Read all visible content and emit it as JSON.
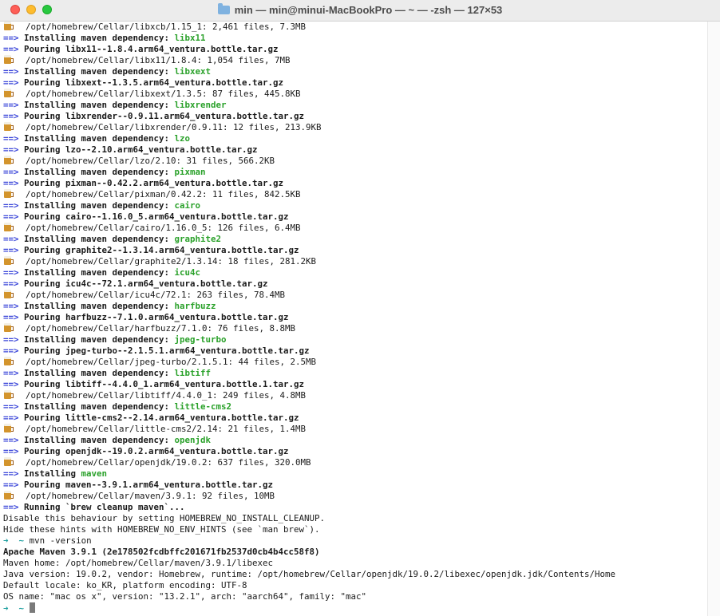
{
  "window": {
    "title": "min — min@minui-MacBookPro — ~ — -zsh — 127×53"
  },
  "terminal": {
    "arrow": "==>",
    "lines": [
      {
        "type": "path",
        "text": "/opt/homebrew/Cellar/libxcb/1.15_1: 2,461 files, 7.3MB"
      },
      {
        "type": "dep",
        "prefix": "Installing maven dependency: ",
        "pkg": "libx11"
      },
      {
        "type": "pour",
        "text": "Pouring libx11--1.8.4.arm64_ventura.bottle.tar.gz"
      },
      {
        "type": "path",
        "text": "/opt/homebrew/Cellar/libx11/1.8.4: 1,054 files, 7MB"
      },
      {
        "type": "dep",
        "prefix": "Installing maven dependency: ",
        "pkg": "libxext"
      },
      {
        "type": "pour",
        "text": "Pouring libxext--1.3.5.arm64_ventura.bottle.tar.gz"
      },
      {
        "type": "path",
        "text": "/opt/homebrew/Cellar/libxext/1.3.5: 87 files, 445.8KB"
      },
      {
        "type": "dep",
        "prefix": "Installing maven dependency: ",
        "pkg": "libxrender"
      },
      {
        "type": "pour",
        "text": "Pouring libxrender--0.9.11.arm64_ventura.bottle.tar.gz"
      },
      {
        "type": "path",
        "text": "/opt/homebrew/Cellar/libxrender/0.9.11: 12 files, 213.9KB"
      },
      {
        "type": "dep",
        "prefix": "Installing maven dependency: ",
        "pkg": "lzo"
      },
      {
        "type": "pour",
        "text": "Pouring lzo--2.10.arm64_ventura.bottle.tar.gz"
      },
      {
        "type": "path",
        "text": "/opt/homebrew/Cellar/lzo/2.10: 31 files, 566.2KB"
      },
      {
        "type": "dep",
        "prefix": "Installing maven dependency: ",
        "pkg": "pixman"
      },
      {
        "type": "pour",
        "text": "Pouring pixman--0.42.2.arm64_ventura.bottle.tar.gz"
      },
      {
        "type": "path",
        "text": "/opt/homebrew/Cellar/pixman/0.42.2: 11 files, 842.5KB"
      },
      {
        "type": "dep",
        "prefix": "Installing maven dependency: ",
        "pkg": "cairo"
      },
      {
        "type": "pour",
        "text": "Pouring cairo--1.16.0_5.arm64_ventura.bottle.tar.gz"
      },
      {
        "type": "path",
        "text": "/opt/homebrew/Cellar/cairo/1.16.0_5: 126 files, 6.4MB"
      },
      {
        "type": "dep",
        "prefix": "Installing maven dependency: ",
        "pkg": "graphite2"
      },
      {
        "type": "pour",
        "text": "Pouring graphite2--1.3.14.arm64_ventura.bottle.tar.gz"
      },
      {
        "type": "path",
        "text": "/opt/homebrew/Cellar/graphite2/1.3.14: 18 files, 281.2KB"
      },
      {
        "type": "dep",
        "prefix": "Installing maven dependency: ",
        "pkg": "icu4c"
      },
      {
        "type": "pour",
        "text": "Pouring icu4c--72.1.arm64_ventura.bottle.tar.gz"
      },
      {
        "type": "path",
        "text": "/opt/homebrew/Cellar/icu4c/72.1: 263 files, 78.4MB"
      },
      {
        "type": "dep",
        "prefix": "Installing maven dependency: ",
        "pkg": "harfbuzz"
      },
      {
        "type": "pour",
        "text": "Pouring harfbuzz--7.1.0.arm64_ventura.bottle.tar.gz"
      },
      {
        "type": "path",
        "text": "/opt/homebrew/Cellar/harfbuzz/7.1.0: 76 files, 8.8MB"
      },
      {
        "type": "dep",
        "prefix": "Installing maven dependency: ",
        "pkg": "jpeg-turbo"
      },
      {
        "type": "pour",
        "text": "Pouring jpeg-turbo--2.1.5.1.arm64_ventura.bottle.tar.gz"
      },
      {
        "type": "path",
        "text": "/opt/homebrew/Cellar/jpeg-turbo/2.1.5.1: 44 files, 2.5MB"
      },
      {
        "type": "dep",
        "prefix": "Installing maven dependency: ",
        "pkg": "libtiff"
      },
      {
        "type": "pour",
        "text": "Pouring libtiff--4.4.0_1.arm64_ventura.bottle.1.tar.gz"
      },
      {
        "type": "path",
        "text": "/opt/homebrew/Cellar/libtiff/4.4.0_1: 249 files, 4.8MB"
      },
      {
        "type": "dep",
        "prefix": "Installing maven dependency: ",
        "pkg": "little-cms2"
      },
      {
        "type": "pour",
        "text": "Pouring little-cms2--2.14.arm64_ventura.bottle.tar.gz"
      },
      {
        "type": "path",
        "text": "/opt/homebrew/Cellar/little-cms2/2.14: 21 files, 1.4MB"
      },
      {
        "type": "dep",
        "prefix": "Installing maven dependency: ",
        "pkg": "openjdk"
      },
      {
        "type": "pour",
        "text": "Pouring openjdk--19.0.2.arm64_ventura.bottle.tar.gz"
      },
      {
        "type": "path",
        "text": "/opt/homebrew/Cellar/openjdk/19.0.2: 637 files, 320.0MB"
      },
      {
        "type": "dep",
        "prefix": "Installing ",
        "pkg": "maven"
      },
      {
        "type": "pour",
        "text": "Pouring maven--3.9.1.arm64_ventura.bottle.tar.gz"
      },
      {
        "type": "path",
        "text": "/opt/homebrew/Cellar/maven/3.9.1: 92 files, 10MB"
      },
      {
        "type": "pour",
        "text": "Running `brew cleanup maven`..."
      },
      {
        "type": "plain",
        "text": "Disable this behaviour by setting HOMEBREW_NO_INSTALL_CLEANUP."
      },
      {
        "type": "plain",
        "text": "Hide these hints with HOMEBREW_NO_ENV_HINTS (see `man brew`)."
      },
      {
        "type": "prompt",
        "symbol": "➜",
        "dir": "~",
        "cmd": "mvn -version"
      },
      {
        "type": "boldplain",
        "text": "Apache Maven 3.9.1 (2e178502fcdbffc201671fb2537d0cb4b4cc58f8)"
      },
      {
        "type": "plain",
        "text": "Maven home: /opt/homebrew/Cellar/maven/3.9.1/libexec"
      },
      {
        "type": "plain",
        "text": "Java version: 19.0.2, vendor: Homebrew, runtime: /opt/homebrew/Cellar/openjdk/19.0.2/libexec/openjdk.jdk/Contents/Home"
      },
      {
        "type": "plain",
        "text": "Default locale: ko_KR, platform encoding: UTF-8"
      },
      {
        "type": "plain",
        "text": "OS name: \"mac os x\", version: \"13.2.1\", arch: \"aarch64\", family: \"mac\""
      },
      {
        "type": "prompt",
        "symbol": "➜",
        "dir": "~",
        "cmd": "",
        "cursor": true
      }
    ]
  }
}
